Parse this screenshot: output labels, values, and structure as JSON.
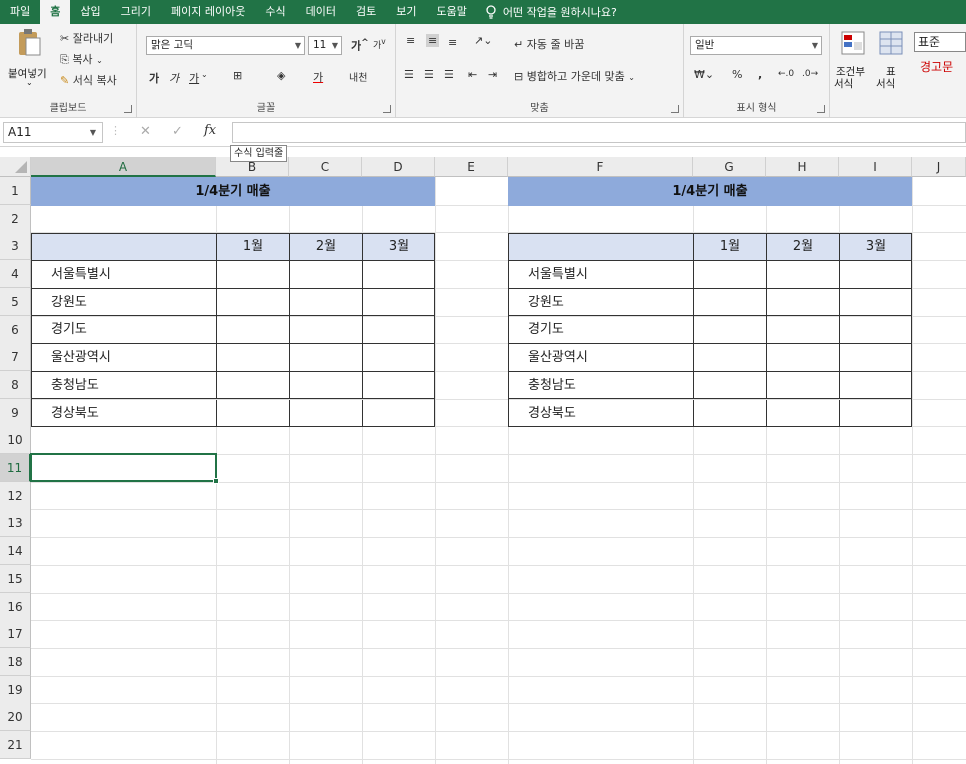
{
  "menu": {
    "tabs": [
      "파일",
      "홈",
      "삽입",
      "그리기",
      "페이지 레이아웃",
      "수식",
      "데이터",
      "검토",
      "보기",
      "도움말"
    ],
    "tell_me": "어떤 작업을 원하시나요?"
  },
  "ribbon": {
    "clipboard": {
      "paste": "붙여넣기",
      "cut": "잘라내기",
      "copy": "복사",
      "format_painter": "서식 복사",
      "label": "클립보드"
    },
    "font": {
      "name": "맑은 고딕",
      "size": "11",
      "bold": "가",
      "italic": "가",
      "underline": "가",
      "label": "글꼴",
      "grow": "가",
      "shrink": "가",
      "phonetic": "내천"
    },
    "align": {
      "wrap": "자동 줄 바꿈",
      "merge": "병합하고 가운데 맞춤",
      "label": "맞춤"
    },
    "number": {
      "format": "일반",
      "label": "표시 형식",
      "percent": "%",
      "comma": ","
    },
    "styles": {
      "cond": "조건부",
      "cond2": "서식",
      "table": "표",
      "table2": "서식",
      "normal": "표준",
      "bad": "경고문"
    }
  },
  "formula_bar": {
    "name_box": "A11",
    "value": "",
    "tooltip": "수식 입력줄"
  },
  "columns": [
    "A",
    "B",
    "C",
    "D",
    "E",
    "F",
    "G",
    "H",
    "I",
    "J"
  ],
  "rows": [
    "1",
    "2",
    "3",
    "4",
    "5",
    "6",
    "7",
    "8",
    "9",
    "10",
    "11",
    "12",
    "13",
    "14",
    "15",
    "16",
    "17",
    "18",
    "19",
    "20",
    "21"
  ],
  "table_left": {
    "title": "1/4분기 매출",
    "months": [
      "1월",
      "2월",
      "3월"
    ],
    "regions": [
      "서울특별시",
      "강원도",
      "경기도",
      "울산광역시",
      "충청남도",
      "경상북도"
    ]
  },
  "table_right": {
    "title": "1/4분기 매출",
    "months": [
      "1월",
      "2월",
      "3월"
    ],
    "regions": [
      "서울특별시",
      "강원도",
      "경기도",
      "울산광역시",
      "충청남도",
      "경상북도"
    ]
  },
  "colors": {
    "accent": "#217346",
    "title_fill": "#8eaadb",
    "header_fill": "#d9e1f2"
  }
}
